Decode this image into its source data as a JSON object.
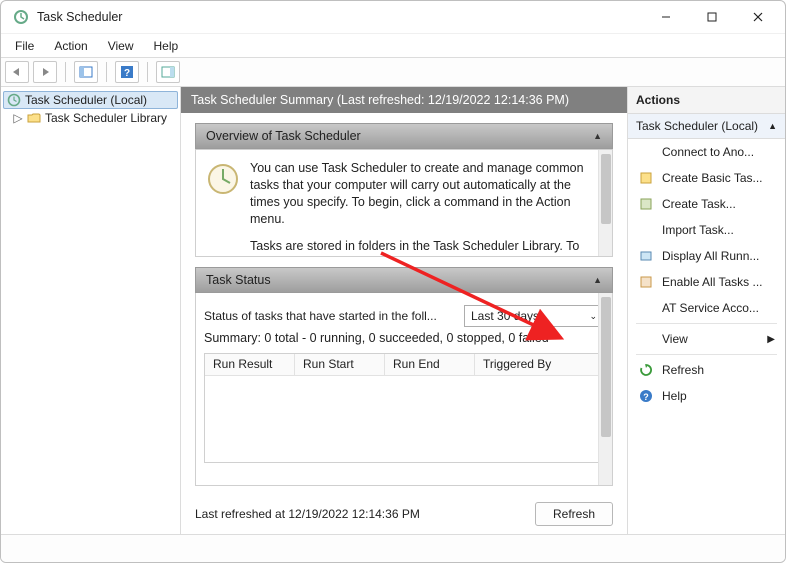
{
  "window": {
    "title": "Task Scheduler"
  },
  "menu": {
    "file": "File",
    "action": "Action",
    "view": "View",
    "help": "Help"
  },
  "tree": {
    "root": "Task Scheduler (Local)",
    "child": "Task Scheduler Library"
  },
  "summary_header": "Task Scheduler Summary (Last refreshed: 12/19/2022 12:14:36 PM)",
  "overview": {
    "title": "Overview of Task Scheduler",
    "p1": "You can use Task Scheduler to create and manage common tasks that your computer will carry out automatically at the times you specify. To begin, click a command in the Action menu.",
    "p2": "Tasks are stored in folders in the Task Scheduler Library. To view or perform an operation on an individual task, select"
  },
  "status": {
    "title": "Task Status",
    "label": "Status of tasks that have started in the foll...",
    "combo": "Last 30 days",
    "summary": "Summary: 0 total - 0 running, 0 succeeded, 0 stopped, 0 failed",
    "cols": {
      "c1": "Run Result",
      "c2": "Run Start",
      "c3": "Run End",
      "c4": "Triggered By"
    }
  },
  "footer": {
    "refreshed": "Last refreshed at 12/19/2022 12:14:36 PM",
    "refresh_btn": "Refresh"
  },
  "actions": {
    "title": "Actions",
    "header": "Task Scheduler (Local)",
    "items": {
      "connect": "Connect to Ano...",
      "basic": "Create Basic Tas...",
      "create": "Create Task...",
      "import": "Import Task...",
      "display": "Display All Runn...",
      "enable": "Enable All Tasks ...",
      "atsvc": "AT Service Acco...",
      "view": "View",
      "refresh": "Refresh",
      "help": "Help"
    }
  }
}
